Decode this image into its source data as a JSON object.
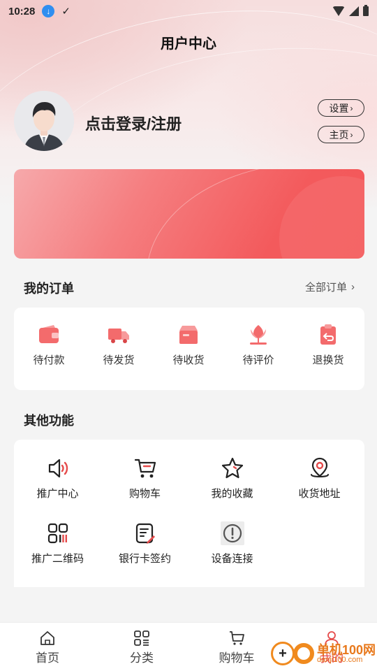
{
  "status_bar": {
    "time": "10:28"
  },
  "header": {
    "title": "用户中心"
  },
  "profile": {
    "login_text": "点击登录/注册",
    "settings_label": "设置",
    "home_label": "主页"
  },
  "orders": {
    "title": "我的订单",
    "all_label": "全部订单",
    "items": [
      {
        "label": "待付款",
        "icon": "wallet-icon"
      },
      {
        "label": "待发货",
        "icon": "truck-icon"
      },
      {
        "label": "待收货",
        "icon": "box-icon"
      },
      {
        "label": "待评价",
        "icon": "flower-icon"
      },
      {
        "label": "退换货",
        "icon": "return-clipboard-icon"
      }
    ]
  },
  "functions": {
    "title": "其他功能",
    "items": [
      {
        "label": "推广中心",
        "icon": "speaker-icon"
      },
      {
        "label": "购物车",
        "icon": "cart-icon"
      },
      {
        "label": "我的收藏",
        "icon": "star-icon"
      },
      {
        "label": "收货地址",
        "icon": "location-pin-icon"
      },
      {
        "label": "推广二维码",
        "icon": "qrcode-icon"
      },
      {
        "label": "银行卡签约",
        "icon": "sign-doc-icon"
      },
      {
        "label": "设备连接",
        "icon": "alert-circle-icon"
      }
    ]
  },
  "tabbar": {
    "items": [
      {
        "label": "首页",
        "icon": "home-icon"
      },
      {
        "label": "分类",
        "icon": "grid-icon"
      },
      {
        "label": "购物车",
        "icon": "cart-icon"
      },
      {
        "label": "我的",
        "icon": "user-icon"
      }
    ]
  },
  "watermark": {
    "main": "单机100网",
    "sub": "danji100.com"
  },
  "colors": {
    "accent": "#f24d50",
    "banner": "#f35a5c"
  }
}
